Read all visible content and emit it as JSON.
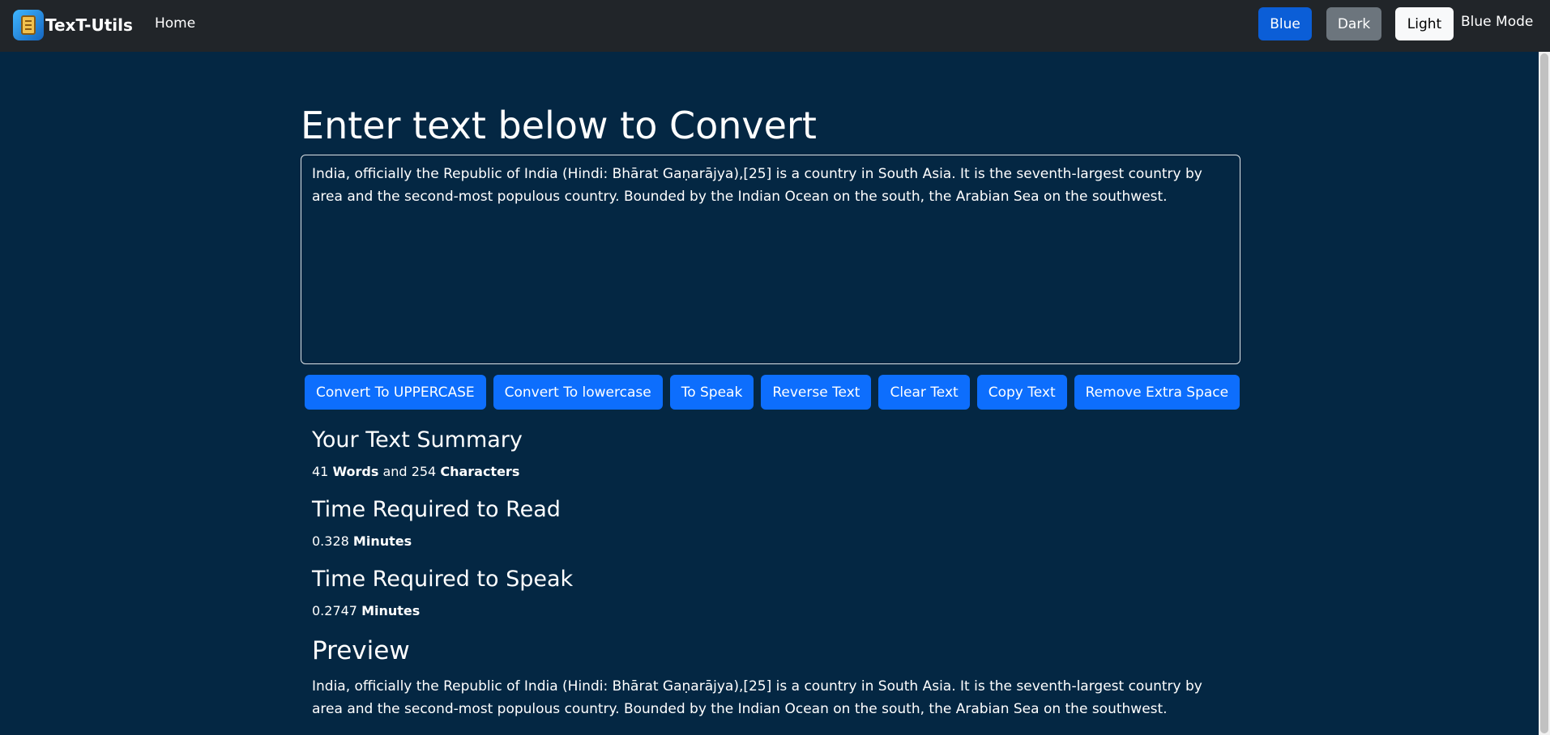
{
  "navbar": {
    "brand": "TexT-Utils",
    "home": "Home",
    "modes": {
      "blue": "Blue",
      "dark": "Dark",
      "light": "Light"
    },
    "mode_label": "Blue Mode"
  },
  "main": {
    "heading": "Enter text below to Convert",
    "text_value": "India, officially the Republic of India (Hindi: Bhārat Gaṇarājya),[25] is a country in South Asia. It is the seventh-largest country by area and the second-most populous country. Bounded by the Indian Ocean on the south, the Arabian Sea on the southwest.",
    "buttons": {
      "uppercase": "Convert To UPPERCASE",
      "lowercase": "Convert To lowercase",
      "speak": "To Speak",
      "reverse": "Reverse Text",
      "clear": "Clear Text",
      "copy": "Copy Text",
      "remove_space": "Remove Extra Space"
    }
  },
  "summary": {
    "heading": "Your Text Summary",
    "word_count": "41",
    "words_label": "Words",
    "and": "and",
    "char_count": "254",
    "chars_label": "Characters",
    "read_heading": "Time Required to Read",
    "read_value": "0.328",
    "speak_heading": "Time Required to Speak",
    "speak_value": "0.2747",
    "minutes_label": "Minutes"
  },
  "preview": {
    "heading": "Preview",
    "text": "India, officially the Republic of India (Hindi: Bhārat Gaṇarājya),[25] is a country in South Asia. It is the seventh-largest country by area and the second-most populous country. Bounded by the Indian Ocean on the south, the Arabian Sea on the southwest."
  },
  "colors": {
    "background": "#042743",
    "navbar": "#212529",
    "primary": "#0d6efd"
  }
}
